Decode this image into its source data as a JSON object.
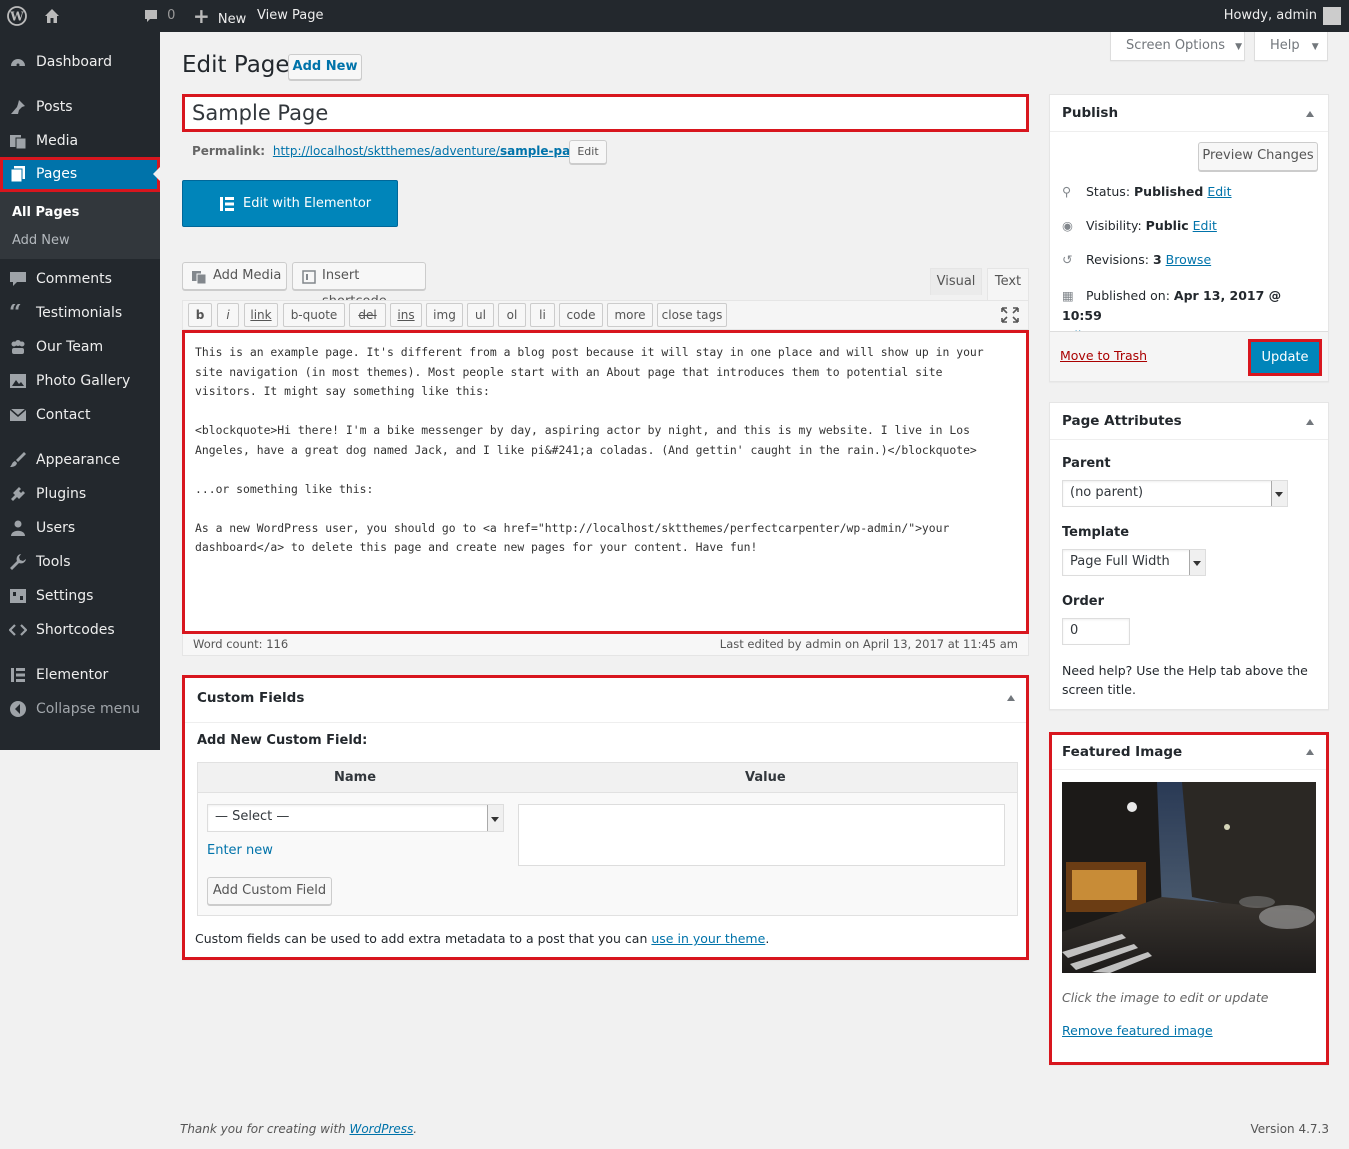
{
  "adminbar": {
    "comments_count": "0",
    "new_label": "New",
    "view_page_label": "View Page",
    "howdy": "Howdy, admin"
  },
  "sidebar": {
    "items": [
      {
        "label": "Dashboard",
        "icon": "dashboard-icon"
      },
      {
        "label": "Posts",
        "icon": "pin-icon"
      },
      {
        "label": "Media",
        "icon": "media-icon"
      },
      {
        "label": "Pages",
        "icon": "pages-icon"
      },
      {
        "label": "Comments",
        "icon": "comment-icon"
      },
      {
        "label": "Testimonials",
        "icon": "quote-icon"
      },
      {
        "label": "Our Team",
        "icon": "group-icon"
      },
      {
        "label": "Photo Gallery",
        "icon": "gallery-icon"
      },
      {
        "label": "Contact",
        "icon": "mail-icon"
      },
      {
        "label": "Appearance",
        "icon": "brush-icon"
      },
      {
        "label": "Plugins",
        "icon": "plugin-icon"
      },
      {
        "label": "Users",
        "icon": "user-icon"
      },
      {
        "label": "Tools",
        "icon": "wrench-icon"
      },
      {
        "label": "Settings",
        "icon": "settings-icon"
      },
      {
        "label": "Shortcodes",
        "icon": "code-icon"
      },
      {
        "label": "Elementor",
        "icon": "elementor-icon"
      },
      {
        "label": "Collapse menu",
        "icon": "collapse-icon"
      }
    ],
    "submenu": [
      "All Pages",
      "Add New"
    ]
  },
  "header": {
    "title": "Edit Page",
    "add_new": "Add New",
    "screen_options": "Screen Options",
    "help": "Help"
  },
  "editor": {
    "post_title": "Sample Page",
    "permalink_label": "Permalink:",
    "permalink_base": "http://localhost/sktthemes/adventure/",
    "permalink_slug": "sample-page",
    "permalink_trail": "/",
    "permalink_edit": "Edit",
    "elementor_btn": "Edit with Elementor",
    "add_media": "Add Media",
    "insert_shortcode": "Insert shortcode",
    "tab_visual": "Visual",
    "tab_text": "Text",
    "quicktags": [
      "b",
      "i",
      "link",
      "b-quote",
      "del",
      "ins",
      "img",
      "ul",
      "ol",
      "li",
      "code",
      "more",
      "close tags"
    ],
    "content": "This is an example page. It's different from a blog post because it will stay in one place and will show up in your\nsite navigation (in most themes). Most people start with an About page that introduces them to potential site\nvisitors. It might say something like this:\n\n<blockquote>Hi there! I'm a bike messenger by day, aspiring actor by night, and this is my website. I live in Los\nAngeles, have a great dog named Jack, and I like pi&#241;a coladas. (And gettin' caught in the rain.)</blockquote>\n\n...or something like this:\n\nAs a new WordPress user, you should go to <a href=\"http://localhost/sktthemes/perfectcarpenter/wp-admin/\">your\ndashboard</a> to delete this page and create new pages for your content. Have fun!",
    "word_count": "Word count: 116",
    "last_edited": "Last edited by admin on April 13, 2017 at 11:45 am"
  },
  "custom_fields": {
    "title": "Custom Fields",
    "add_new_heading": "Add New Custom Field:",
    "col_name": "Name",
    "col_value": "Value",
    "select_value": "— Select —",
    "enter_new": "Enter new",
    "add_button": "Add Custom Field",
    "help_text": "Custom fields can be used to add extra metadata to a post that you can",
    "help_link": "use in your theme",
    "help_period": "."
  },
  "publish": {
    "title": "Publish",
    "preview": "Preview Changes",
    "status_label": "Status:",
    "status_value": "Published",
    "visibility_label": "Visibility:",
    "visibility_value": "Public",
    "revisions_label": "Revisions:",
    "revisions_value": "3",
    "browse": "Browse",
    "published_label": "Published on:",
    "published_value": "Apr 13, 2017 @ 10:59",
    "edit": "Edit",
    "trash": "Move to Trash",
    "update": "Update"
  },
  "attributes": {
    "title": "Page Attributes",
    "parent_label": "Parent",
    "parent_value": "(no parent)",
    "template_label": "Template",
    "template_value": "Page Full Width",
    "order_label": "Order",
    "order_value": "0",
    "help": "Need help? Use the Help tab above the screen title."
  },
  "featured": {
    "title": "Featured Image",
    "caption": "Click the image to edit or update",
    "remove": "Remove featured image"
  },
  "footer": {
    "thanks": "Thank you for creating with",
    "wp_link": "WordPress",
    "period": ".",
    "version": "Version 4.7.3"
  },
  "colors": {
    "accent": "#0073aa",
    "highlight_border": "#d8161e",
    "sidebar_bg": "#23282d"
  }
}
